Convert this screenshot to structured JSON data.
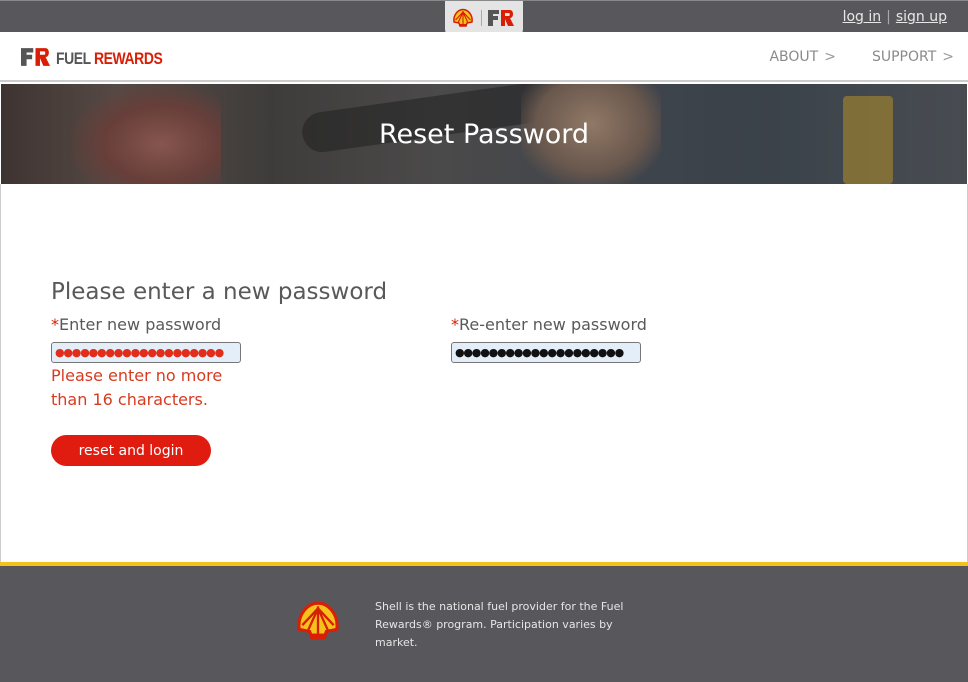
{
  "topbar": {
    "login_label": "log in",
    "separator": "|",
    "signup_label": "sign up"
  },
  "navbar": {
    "logo": {
      "fuel": "FUEL",
      "rewards": "REWARDS"
    },
    "links": [
      {
        "label": "ABOUT",
        "chevron": ">"
      },
      {
        "label": "SUPPORT",
        "chevron": ">"
      }
    ]
  },
  "hero": {
    "title": "Reset Password"
  },
  "form": {
    "title": "Please enter a new password",
    "required_marker": "*",
    "new_password": {
      "label": "Enter new password",
      "value": "●●●●●●●●●●●●●●●●●●●●",
      "error": "Please enter no more than 16 characters."
    },
    "confirm_password": {
      "label": "Re-enter new password",
      "value": "●●●●●●●●●●●●●●●●●●●●"
    },
    "submit_label": "reset and login"
  },
  "footer": {
    "text": "Shell is the national fuel provider for the Fuel Rewards® program. Participation varies by market."
  },
  "colors": {
    "brand_red": "#e01b0f",
    "dark_gray": "#58575c",
    "shell_yellow": "#f4c21a",
    "input_bg": "#e4eef9"
  },
  "icons": [
    "shell-logo-icon",
    "fuel-rewards-logo-icon",
    "chevron-right-icon"
  ]
}
